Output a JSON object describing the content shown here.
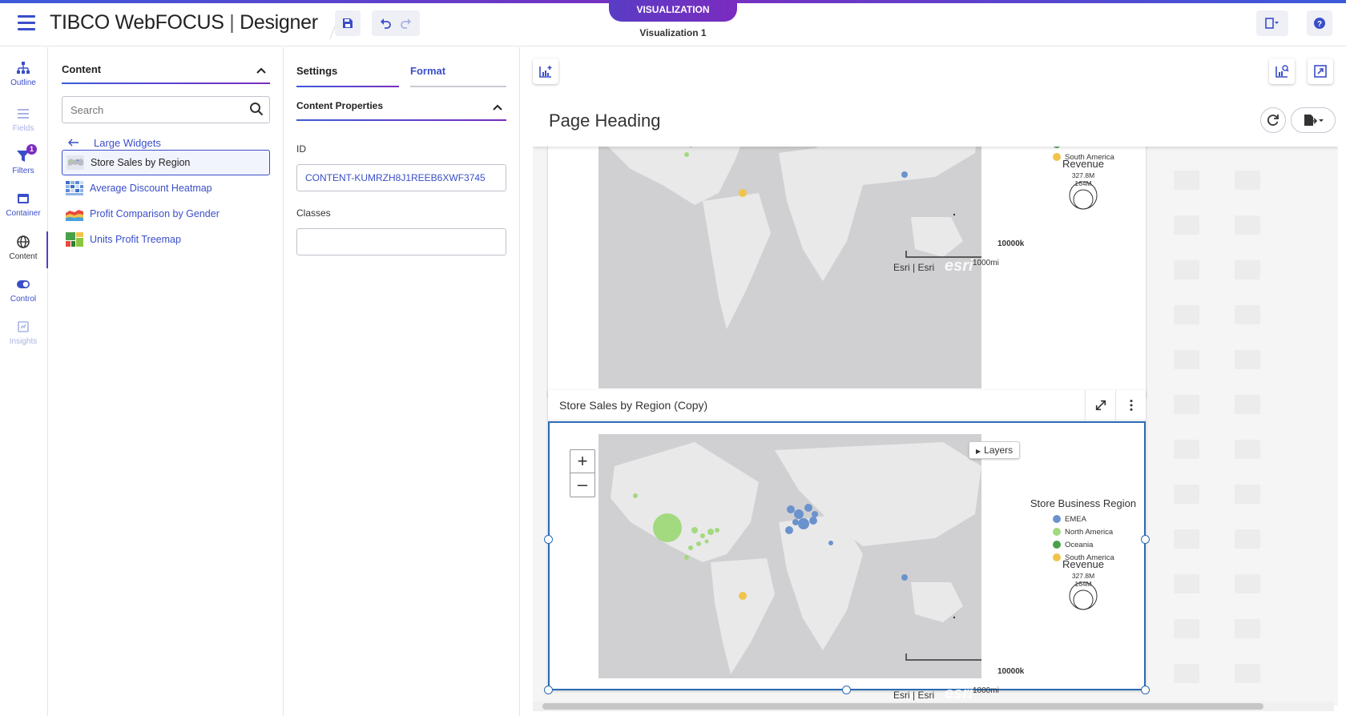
{
  "app": {
    "brand": "TIBCO WebFOCUS",
    "product": "Designer",
    "mode_pill": "VISUALIZATION",
    "document_title": "Visualization 1"
  },
  "rail": [
    {
      "label": "Outline",
      "icon": "outline-icon"
    },
    {
      "label": "Fields",
      "icon": "fields-icon"
    },
    {
      "label": "Filters",
      "icon": "filters-icon",
      "badge": "1"
    },
    {
      "label": "Container",
      "icon": "container-icon"
    },
    {
      "label": "Content",
      "icon": "globe-icon"
    },
    {
      "label": "Control",
      "icon": "toggle-icon"
    },
    {
      "label": "Insights",
      "icon": "insights-icon"
    }
  ],
  "content_panel": {
    "title": "Content",
    "search_placeholder": "Search",
    "back_label": "Large Widgets",
    "widgets": [
      {
        "label": "Store Sales by Region",
        "selected": true
      },
      {
        "label": "Average Discount Heatmap",
        "selected": false
      },
      {
        "label": "Profit Comparison by Gender",
        "selected": false
      },
      {
        "label": "Units Profit Treemap",
        "selected": false
      }
    ]
  },
  "settings_panel": {
    "tab_settings": "Settings",
    "tab_format": "Format",
    "section_title": "Content Properties",
    "id_label": "ID",
    "id_value": "CONTENT-KUMRZH8J1REEB6XWF3745",
    "classes_label": "Classes",
    "classes_value": ""
  },
  "canvas": {
    "page_heading": "Page Heading",
    "card2_title": "Store Sales by Region (Copy)",
    "layers_label": "Layers",
    "zoom_in": "+",
    "zoom_out": "–",
    "legend_title": "Store Business Region",
    "legend_items": [
      {
        "label": "EMEA",
        "color": "#6a93cd"
      },
      {
        "label": "North America",
        "color": "#a3d97f"
      },
      {
        "label": "Oceania",
        "color": "#4aa04a"
      },
      {
        "label": "South America",
        "color": "#f2c34c"
      }
    ],
    "revenue_title": "Revenue",
    "revenue_max": "327.8M",
    "revenue_mid": "164M",
    "attribution": "Esri | Esri",
    "esri_logo": "esri",
    "scale_km": "10000k",
    "scale_mi": "1000mi"
  },
  "colors": {
    "accent": "#3a4ec9",
    "brand_purple": "#7b2cbf",
    "selection": "#2b6bb3"
  }
}
